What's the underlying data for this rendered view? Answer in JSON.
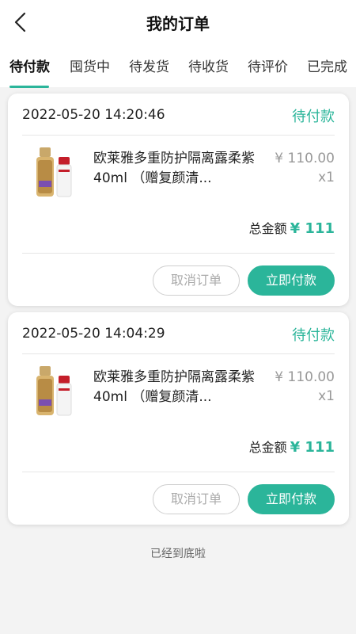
{
  "header": {
    "title": "我的订单",
    "back_icon": "chevron-left-icon"
  },
  "tabs": [
    {
      "label": "待付款",
      "active": true
    },
    {
      "label": "囤货中",
      "active": false
    },
    {
      "label": "待发货",
      "active": false
    },
    {
      "label": "待收货",
      "active": false
    },
    {
      "label": "待评价",
      "active": false
    },
    {
      "label": "已完成",
      "active": false
    }
  ],
  "orders": [
    {
      "datetime": "2022-05-20 14:20:46",
      "status": "待付款",
      "product_name": "欧莱雅多重防护隔离露柔紫40ml （赠复颜清...",
      "price": "¥ 110.00",
      "quantity": "x1",
      "total_label": "总金额",
      "total_amount": "¥ 111",
      "cancel_label": "取消订单",
      "pay_label": "立即付款"
    },
    {
      "datetime": "2022-05-20 14:04:29",
      "status": "待付款",
      "product_name": "欧莱雅多重防护隔离露柔紫40ml （赠复颜清...",
      "price": "¥ 110.00",
      "quantity": "x1",
      "total_label": "总金额",
      "total_amount": "¥ 111",
      "cancel_label": "取消订单",
      "pay_label": "立即付款"
    }
  ],
  "footer": {
    "end_text": "已经到底啦"
  },
  "colors": {
    "accent": "#2bb59a",
    "background": "#f3f3f3"
  }
}
